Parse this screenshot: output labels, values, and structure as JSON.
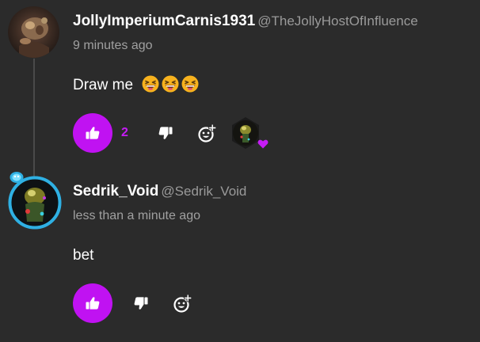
{
  "comments": [
    {
      "username": "JollyImperiumCarnis1931",
      "handle": "@TheJollyHostOfInfluence",
      "timestamp": "9 minutes ago",
      "text": "Draw me",
      "emojis": [
        "grinning-squinting-face",
        "grinning-squinting-face",
        "grinning-squinting-face"
      ],
      "like_count": "2",
      "reaction": {
        "icon": "heart-icon",
        "color": "#c61cf5"
      }
    },
    {
      "username": "Sedrik_Void",
      "handle": "@Sedrik_Void",
      "timestamp": "less than a minute ago",
      "text": "bet",
      "emojis": [],
      "like_count": "",
      "avatar_ring_color": "#2fb0e3"
    }
  ],
  "colors": {
    "background": "#2b2b2b",
    "accent": "#c012f2",
    "muted_text": "#9a9a9a",
    "thread_line": "#4a4a4a"
  },
  "icons": {
    "like": "thumbs-up-icon",
    "dislike": "thumbs-down-icon",
    "add_reaction": "add-reaction-icon",
    "badge": "avatar-badge-icon"
  }
}
